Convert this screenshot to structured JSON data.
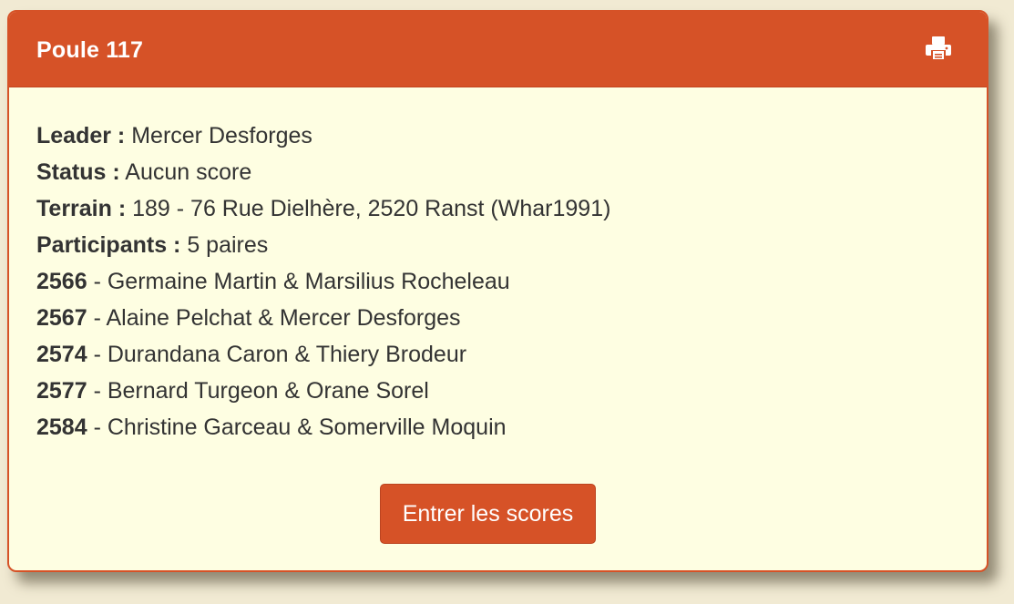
{
  "panel": {
    "title": "Poule 117",
    "print_icon": "print-icon"
  },
  "info": {
    "leader_label": "Leader :",
    "leader_value": "Mercer Desforges",
    "status_label": "Status :",
    "status_value": "Aucun score",
    "terrain_label": "Terrain :",
    "terrain_value": "189 - 76 Rue Dielhère, 2520 Ranst (Whar1991)",
    "participants_label": "Participants :",
    "participants_value": "5 paires"
  },
  "pairs": [
    {
      "id": "2566",
      "names": "Germaine Martin & Marsilius Rocheleau"
    },
    {
      "id": "2567",
      "names": "Alaine Pelchat & Mercer Desforges"
    },
    {
      "id": "2574",
      "names": "Durandana Caron & Thiery Brodeur"
    },
    {
      "id": "2577",
      "names": "Bernard Turgeon & Orane Sorel"
    },
    {
      "id": "2584",
      "names": "Christine Garceau & Somerville Moquin"
    }
  ],
  "pair_separator": " - ",
  "actions": {
    "enter_scores_label": "Entrer les scores"
  },
  "colors": {
    "accent": "#d65227",
    "panel_background": "#fefee2",
    "page_background": "#f1ead3",
    "text": "#333333"
  }
}
